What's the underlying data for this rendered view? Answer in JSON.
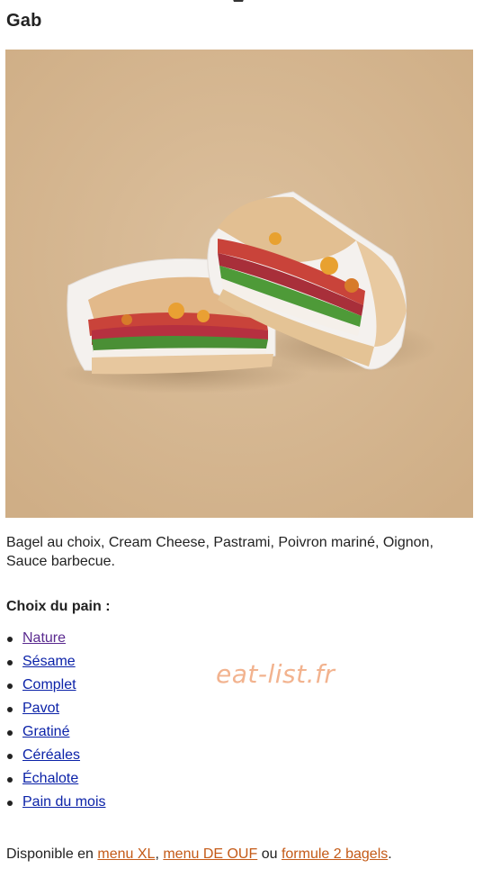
{
  "product": {
    "title": "Gab",
    "description": "Bagel au choix, Cream Cheese, Pastrami, Poivron mariné, Oignon, Sauce barbecue."
  },
  "bread_choice": {
    "heading": "Choix du pain :",
    "options": [
      "Nature",
      "Sésame",
      "Complet",
      "Pavot",
      "Gratiné",
      "Céréales",
      "Échalote",
      "Pain du mois"
    ]
  },
  "watermark": "eat-list.fr",
  "availability": {
    "prefix": "Disponible en ",
    "link1": "menu XL",
    "sep1": ", ",
    "link2": "menu DE OUF",
    "sep2": " ou ",
    "link3": "formule 2 bagels",
    "suffix": "."
  },
  "colors": {
    "background": "#ffffff",
    "image_background": "#d9b995",
    "link": "#0b22a8",
    "visited_link": "#5a2a8f",
    "availability_link": "#c45a17",
    "watermark": "#f2b38f"
  },
  "icons": {
    "top": "bag-icon",
    "bullet": "bullet-icon"
  }
}
